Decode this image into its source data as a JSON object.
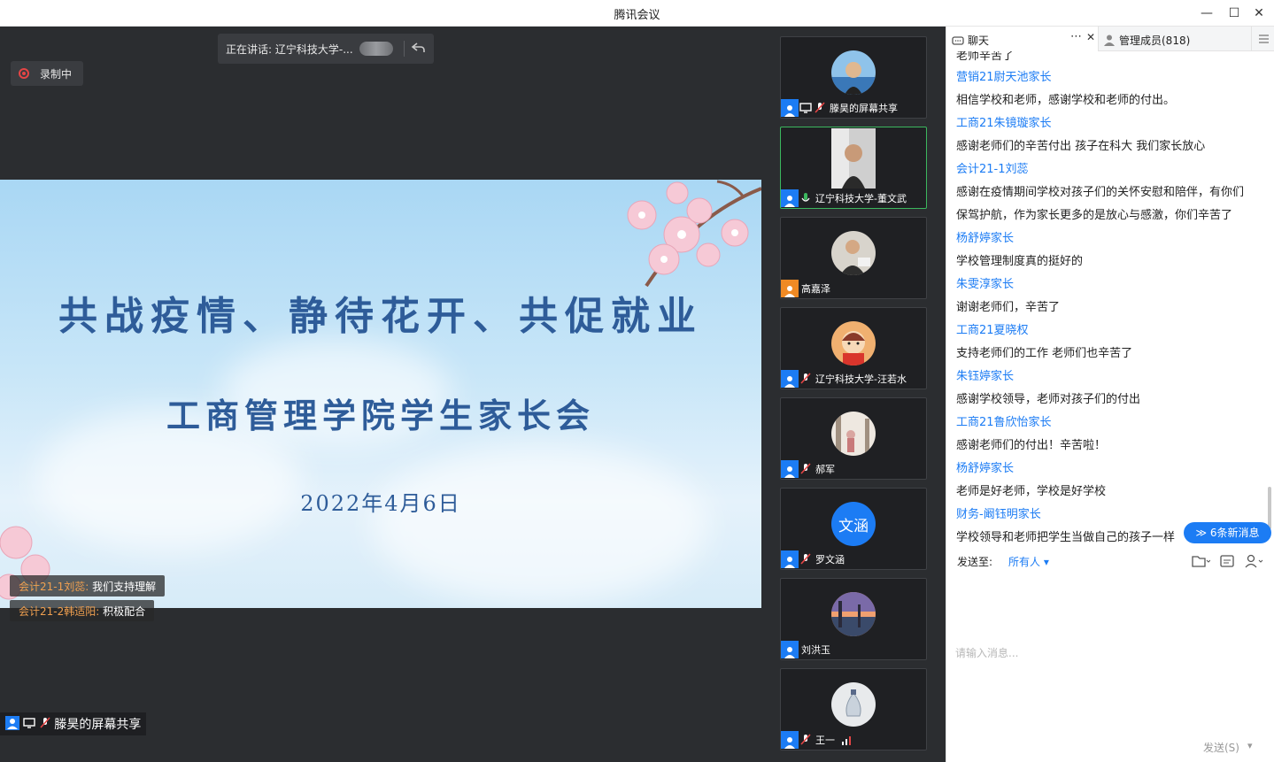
{
  "window": {
    "title": "腾讯会议",
    "minimize": "—",
    "maximize": "☐",
    "close": "✕"
  },
  "stage": {
    "speaking_text": "正在讲话: 辽宁科技大学-...",
    "recording_label": "录制中",
    "slide": {
      "title": "共战疫情、静待花开、共促就业",
      "subtitle": "工商管理学院学生家长会",
      "date": "2022年4月6日"
    },
    "danmu": [
      {
        "name": "会计21-1刘蕊:",
        "message": "我们支持理解"
      },
      {
        "name": "会计21-2韩适阳:",
        "message": "积极配合"
      }
    ],
    "share_label": "滕昊的屏幕共享"
  },
  "gallery": {
    "tiles": [
      {
        "name": "滕昊的屏幕共享",
        "avatar": "photo-man-blue",
        "badge_color": "blue",
        "mic": "muted",
        "screen_share": true
      },
      {
        "name": "辽宁科技大学-董文武",
        "avatar": "video-man",
        "badge_color": "blue",
        "mic": "active",
        "active": true
      },
      {
        "name": "高嘉泽",
        "avatar": "photo-man",
        "badge_color": "orange",
        "mic": "none"
      },
      {
        "name": "辽宁科技大学-汪若水",
        "avatar": "cartoon-red",
        "badge_color": "blue",
        "mic": "muted"
      },
      {
        "name": "郝军",
        "avatar": "photo-garden",
        "badge_color": "blue",
        "mic": "muted"
      },
      {
        "name": "罗文涵",
        "avatar_text": "文涵",
        "badge_color": "blue",
        "mic": "muted"
      },
      {
        "name": "刘洪玉",
        "avatar": "photo-city",
        "badge_color": "blue",
        "mic": "none"
      },
      {
        "name": "王一",
        "avatar": "photo-vase",
        "badge_color": "blue",
        "mic": "muted",
        "signal": true
      }
    ]
  },
  "chat": {
    "tab_chat": "聊天",
    "tab_members": "管理成员(818)",
    "messages": [
      {
        "sender": "营销21尉天池家长",
        "text": "相信学校和老师，感谢学校和老师的付出。"
      },
      {
        "sender": "工商21朱镜璇家长",
        "text": "感谢老师们的辛苦付出 孩子在科大 我们家长放心"
      },
      {
        "sender": "会计21-1刘蕊",
        "text": "感谢在疫情期间学校对孩子们的关怀安慰和陪伴，有你们",
        "text2": "保驾护航，作为家长更多的是放心与感激，你们辛苦了"
      },
      {
        "sender": "杨舒婷家长",
        "text": "学校管理制度真的挺好的"
      },
      {
        "sender": "朱雯淳家长",
        "text": "谢谢老师们，辛苦了"
      },
      {
        "sender": "工商21夏晓权",
        "text": "支持老师们的工作 老师们也辛苦了"
      },
      {
        "sender": "朱钰婷家长",
        "text": "感谢学校领导，老师对孩子们的付出"
      },
      {
        "sender": "工商21鲁欣怡家长",
        "text": "感谢老师们的付出！辛苦啦！"
      },
      {
        "sender": "杨舒婷家长",
        "text": "老师是好老师，学校是好学校"
      },
      {
        "sender": "财务-阚钰明家长",
        "text": "学校领导和老师把学生当做自己的孩子一样"
      }
    ],
    "partial_top": "老师辛苦了",
    "new_messages": "≫ 6条新消息",
    "send_to_label": "发送至:",
    "send_to_value": "所有人 ▾",
    "input_placeholder": "请输入消息...",
    "send_button": "发送(S)",
    "send_arrow": "▾"
  }
}
